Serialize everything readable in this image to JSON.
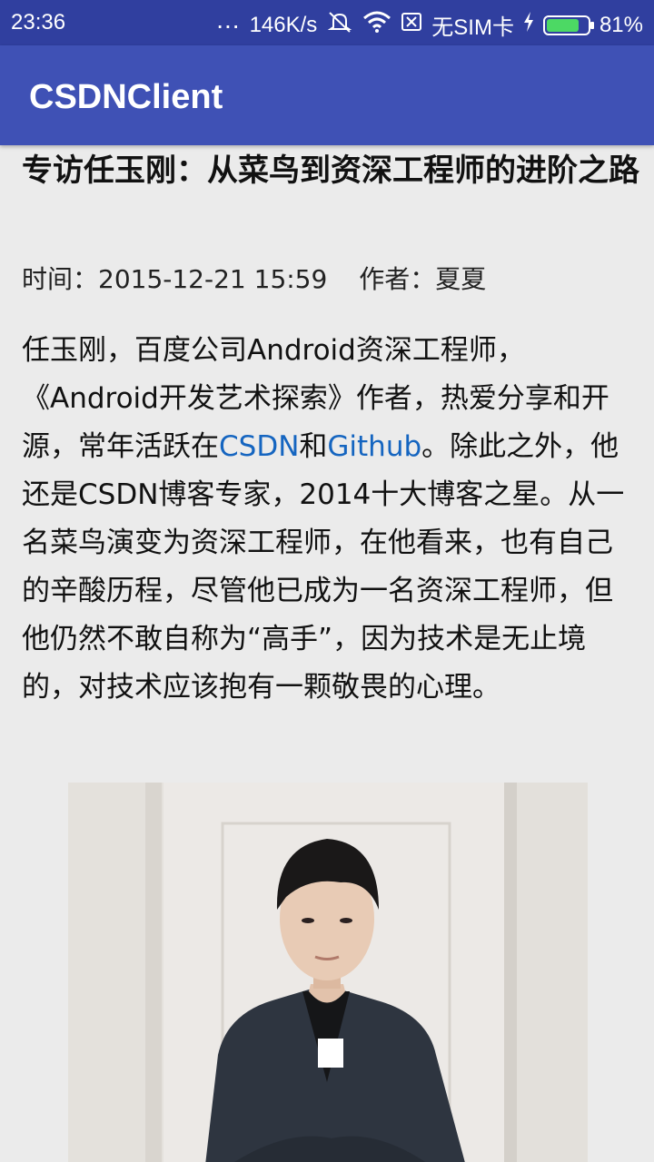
{
  "status_bar": {
    "time": "23:36",
    "dots": "...",
    "network_speed": "146K/s",
    "sim_status": "无SIM卡",
    "battery_percent": "81%",
    "battery_level": 0.81,
    "icons": [
      "mute-icon",
      "wifi-icon",
      "no-sim-icon",
      "charging-icon",
      "battery-icon"
    ]
  },
  "app_bar": {
    "title": "CSDNClient"
  },
  "article": {
    "title": "专访任玉刚：从菜鸟到资深工程师的进阶之路",
    "time": "时间：2015-12-21 15:59",
    "author": "作者：夏夏",
    "body_part1": "任玉刚，百度公司Android资深工程师，《Android开发艺术探索》作者，热爱分享和开源，常年活跃在",
    "link1": "CSDN",
    "body_part2": "和",
    "link2": "Github",
    "body_part3": "。除此之外，他还是CSDN博客专家，2014十大博客之星。从一名菜鸟演变为资深工程师，在他看来，也有自己的辛酸历程，尽管他已成为一名资深工程师，但他仍然不敢自称为“高手”，因为技术是无止境的，对技术应该抱有一颗敬畏的心理。"
  },
  "colors": {
    "status_bar": "#303f9f",
    "app_bar": "#3f51b5",
    "link": "#1565c0",
    "background": "#ebebeb"
  }
}
